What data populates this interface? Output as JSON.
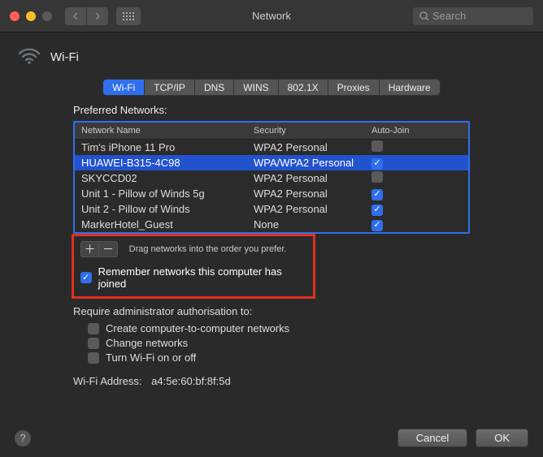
{
  "window": {
    "title": "Network",
    "search_placeholder": "Search"
  },
  "header": {
    "label": "Wi-Fi"
  },
  "tabs": [
    "Wi-Fi",
    "TCP/IP",
    "DNS",
    "WINS",
    "802.1X",
    "Proxies",
    "Hardware"
  ],
  "active_tab": "Wi-Fi",
  "preferred_label": "Preferred Networks:",
  "columns": {
    "name": "Network Name",
    "security": "Security",
    "auto": "Auto-Join"
  },
  "networks": [
    {
      "name": "Tim's iPhone 11 Pro",
      "security": "WPA2 Personal",
      "auto": false,
      "selected": false
    },
    {
      "name": "HUAWEI-B315-4C98",
      "security": "WPA/WPA2 Personal",
      "auto": true,
      "selected": true
    },
    {
      "name": "SKYCCD02",
      "security": "WPA2 Personal",
      "auto": false,
      "selected": false
    },
    {
      "name": "Unit 1 - Pillow of Winds 5g",
      "security": "WPA2 Personal",
      "auto": true,
      "selected": false
    },
    {
      "name": "Unit 2 - Pillow of Winds",
      "security": "WPA2 Personal",
      "auto": true,
      "selected": false
    },
    {
      "name": "MarkerHotel_Guest",
      "security": "None",
      "auto": true,
      "selected": false
    }
  ],
  "drag_hint": "Drag networks into the order you prefer.",
  "remember": {
    "label": "Remember networks this computer has joined",
    "checked": true
  },
  "auth": {
    "label": "Require administrator authorisation to:",
    "options": [
      {
        "label": "Create computer-to-computer networks",
        "checked": false
      },
      {
        "label": "Change networks",
        "checked": false
      },
      {
        "label": "Turn Wi-Fi on or off",
        "checked": false
      }
    ]
  },
  "wifi_address": {
    "label": "Wi-Fi Address:",
    "value": "a4:5e:60:bf:8f:5d"
  },
  "buttons": {
    "cancel": "Cancel",
    "ok": "OK"
  }
}
